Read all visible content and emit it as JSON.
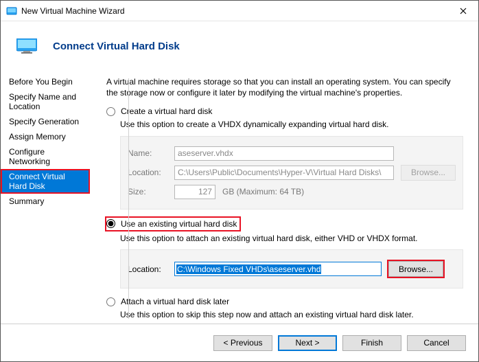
{
  "window": {
    "title": "New Virtual Machine Wizard"
  },
  "header": {
    "title": "Connect Virtual Hard Disk"
  },
  "sidebar": {
    "items": [
      {
        "label": "Before You Begin"
      },
      {
        "label": "Specify Name and Location"
      },
      {
        "label": "Specify Generation"
      },
      {
        "label": "Assign Memory"
      },
      {
        "label": "Configure Networking"
      },
      {
        "label": "Connect Virtual Hard Disk"
      },
      {
        "label": "Summary"
      }
    ],
    "active_index": 5
  },
  "content": {
    "intro": "A virtual machine requires storage so that you can install an operating system. You can specify the storage now or configure it later by modifying the virtual machine's properties.",
    "option1": {
      "label": "Create a virtual hard disk",
      "desc": "Use this option to create a VHDX dynamically expanding virtual hard disk.",
      "name_label": "Name:",
      "name_value": "aseserver.vhdx",
      "loc_label": "Location:",
      "loc_value": "C:\\Users\\Public\\Documents\\Hyper-V\\Virtual Hard Disks\\",
      "browse_label": "Browse...",
      "size_label": "Size:",
      "size_value": "127",
      "size_unit": "GB (Maximum: 64 TB)"
    },
    "option2": {
      "label": "Use an existing virtual hard disk",
      "desc": "Use this option to attach an existing virtual hard disk, either VHD or VHDX format.",
      "loc_label": "Location:",
      "loc_value": "C:\\Windows Fixed VHDs\\aseserver.vhd",
      "browse_label": "Browse..."
    },
    "option3": {
      "label": "Attach a virtual hard disk later",
      "desc": "Use this option to skip this step now and attach an existing virtual hard disk later."
    }
  },
  "footer": {
    "previous": "< Previous",
    "next": "Next >",
    "finish": "Finish",
    "cancel": "Cancel"
  }
}
